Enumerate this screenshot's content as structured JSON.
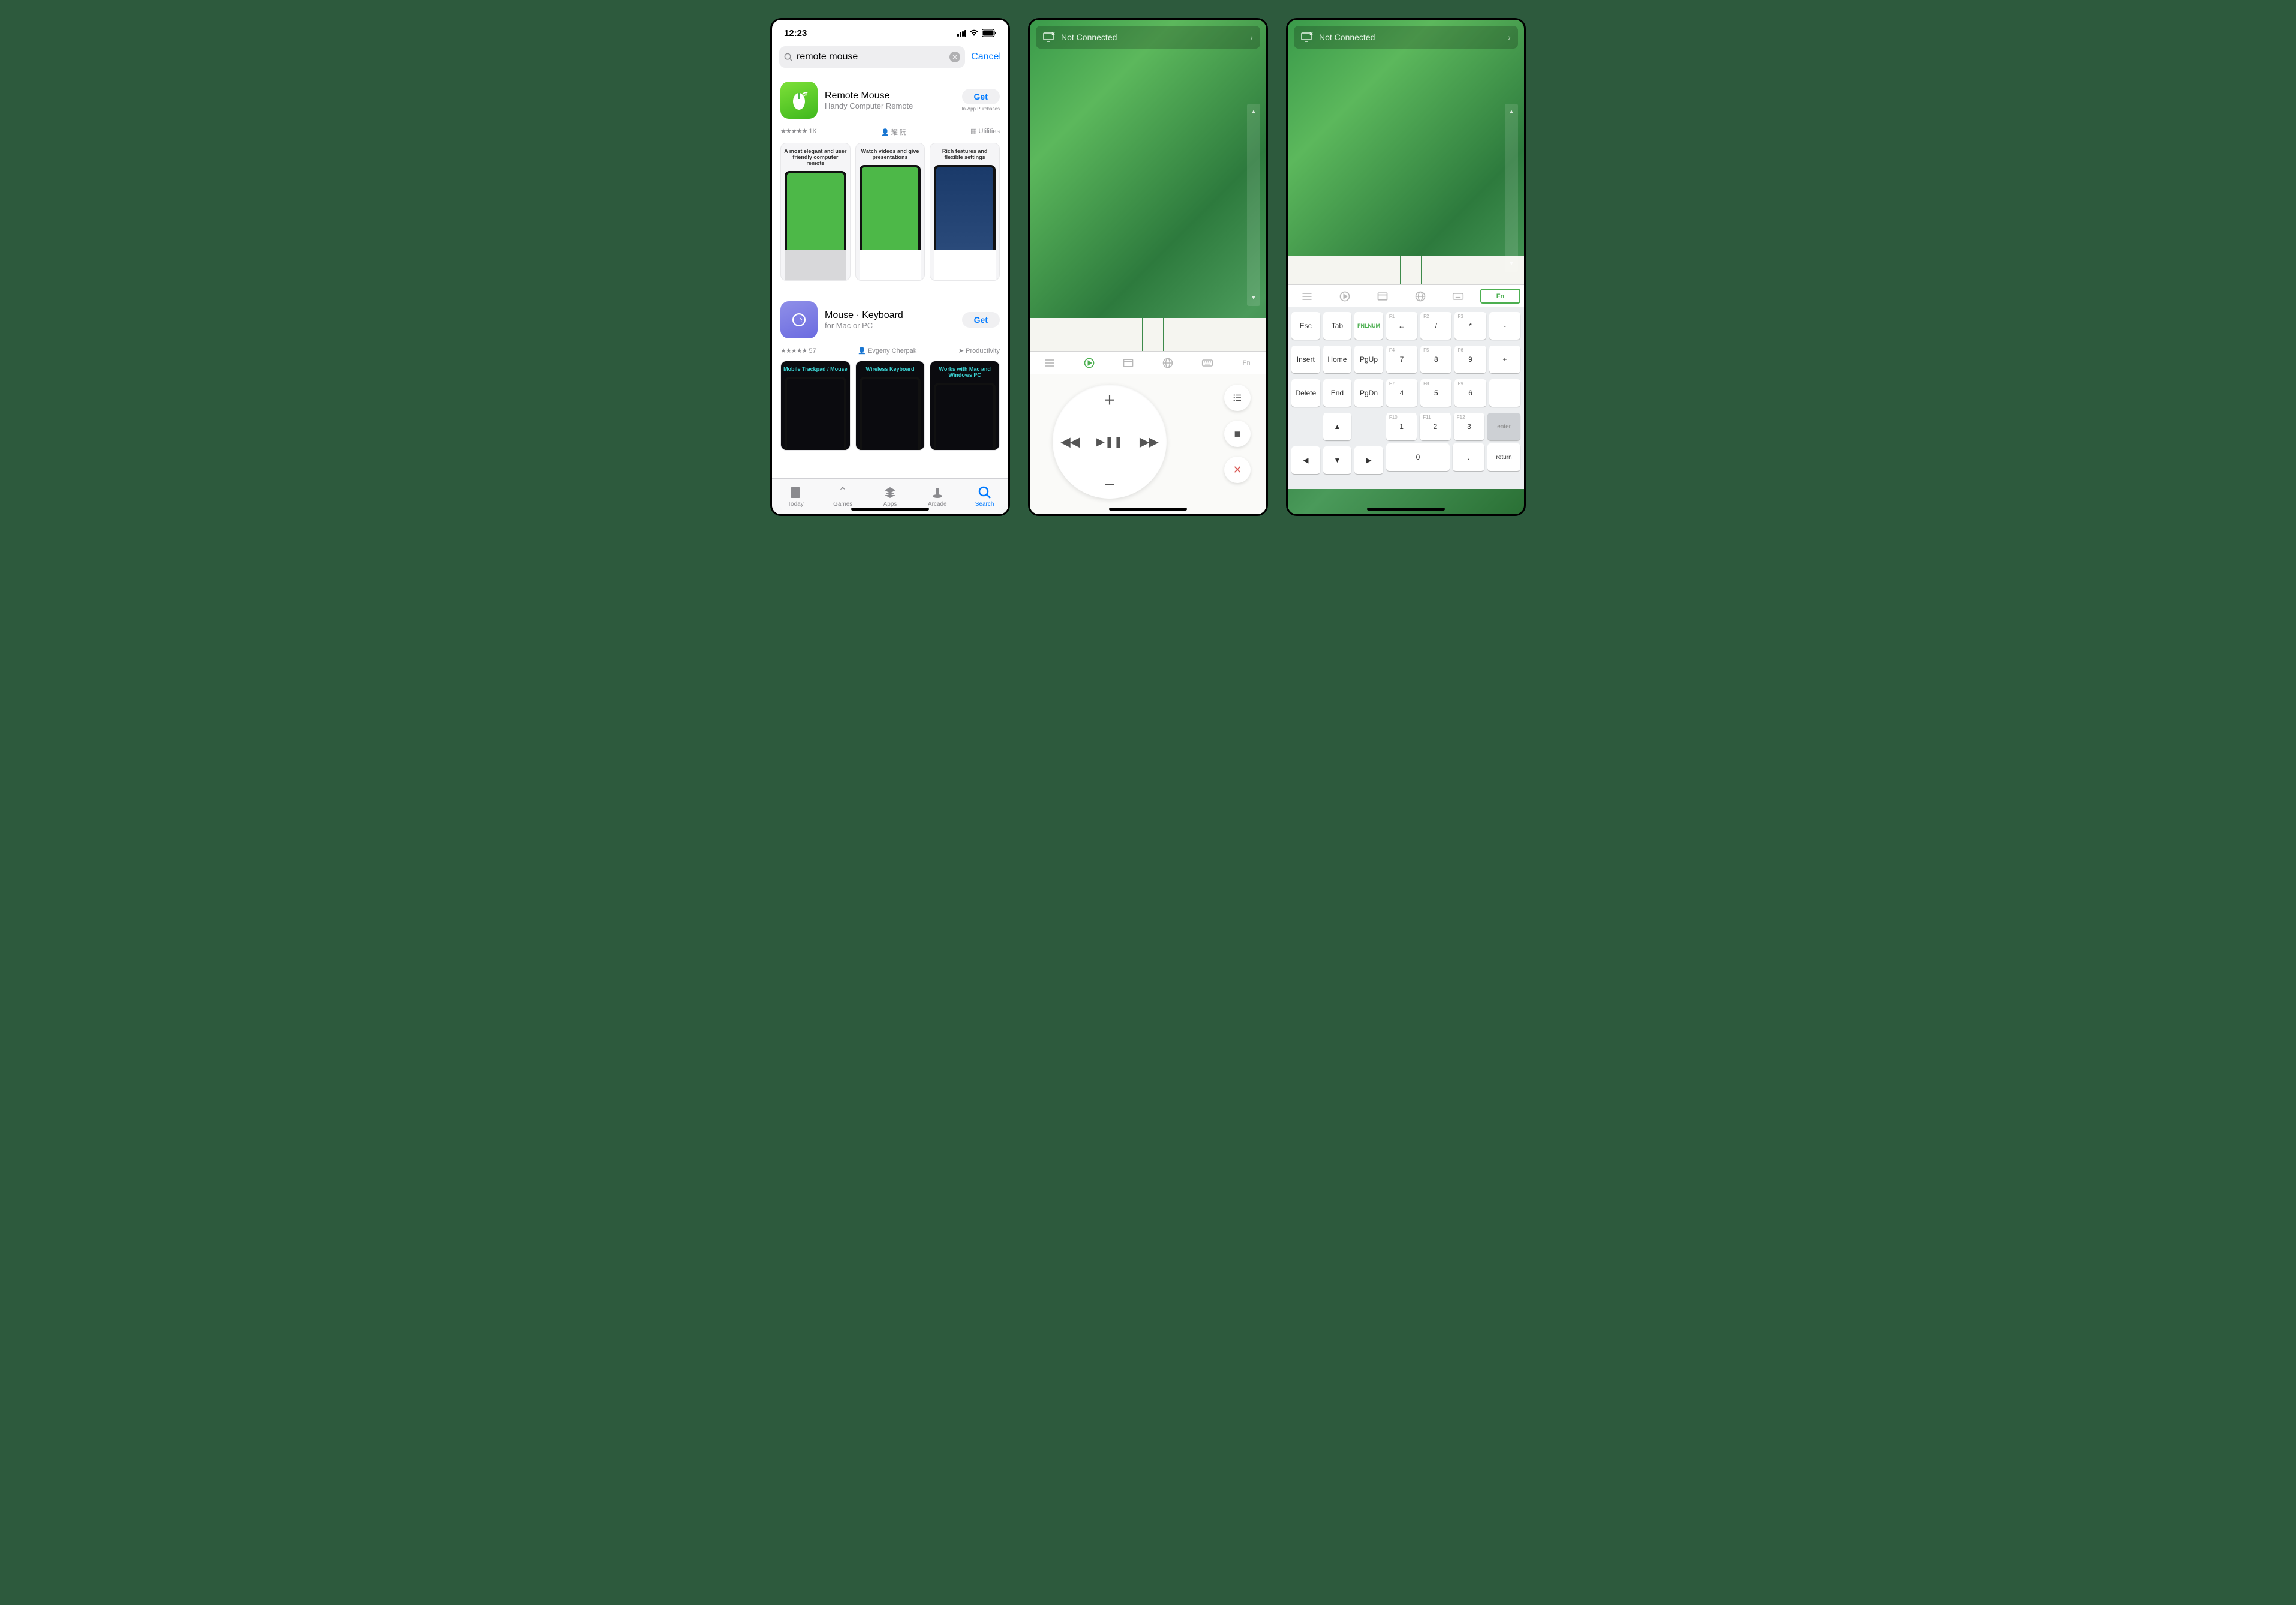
{
  "appstore": {
    "status": {
      "time": "12:23"
    },
    "search": {
      "value": "remote mouse",
      "cancel": "Cancel"
    },
    "apps": [
      {
        "title": "Remote Mouse",
        "subtitle": "Handy Computer Remote",
        "get": "Get",
        "iap": "In-App Purchases",
        "rating_stars": "★★★★★",
        "rating_count": "1K",
        "developer": "耀 阮",
        "category": "Utilities",
        "shots": [
          "A most elegant and user friendly computer remote",
          "Watch videos and give presentations",
          "Rich features and flexible settings"
        ]
      },
      {
        "title": "Mouse · Keyboard",
        "subtitle": "for Mac or PC",
        "get": "Get",
        "iap": "",
        "rating_stars": "★★★★★",
        "rating_count": "57",
        "developer": "Evgeny Cherpak",
        "category": "Productivity",
        "shots": [
          "Mobile Trackpad / Mouse",
          "Wireless Keyboard",
          "Works with Mac and Windows PC"
        ]
      }
    ],
    "tabs": {
      "today": "Today",
      "games": "Games",
      "apps": "Apps",
      "arcade": "Arcade",
      "search": "Search"
    }
  },
  "remote": {
    "banner": "Not Connected",
    "media": {
      "play_pause": "▶❚❚",
      "vol_up": "＋",
      "vol_down": "－",
      "rw": "◀◀",
      "ff": "▶▶",
      "list": "≡",
      "stop": "■",
      "close": "✕"
    },
    "modebar_fn": "Fn"
  },
  "fnkeys": {
    "r1": {
      "esc": "Esc",
      "tab": "Tab",
      "numlock_top": "FN",
      "numlock_bot": "LNUM",
      "f1": {
        "sup": "F1",
        "lbl": "←"
      },
      "f2": {
        "sup": "F2",
        "lbl": "/"
      },
      "f3": {
        "sup": "F3",
        "lbl": "*"
      },
      "minus": "-"
    },
    "r2": {
      "insert": "Insert",
      "home": "Home",
      "pgup": "PgUp",
      "f4": {
        "sup": "F4",
        "lbl": "7"
      },
      "f5": {
        "sup": "F5",
        "lbl": "8"
      },
      "f6": {
        "sup": "F6",
        "lbl": "9"
      },
      "plus": "+"
    },
    "r3": {
      "delete": "Delete",
      "end": "End",
      "pgdn": "PgDn",
      "f7": {
        "sup": "F7",
        "lbl": "4"
      },
      "f8": {
        "sup": "F8",
        "lbl": "5"
      },
      "f9": {
        "sup": "F9",
        "lbl": "6"
      },
      "eq": "="
    },
    "r4": {
      "up": "▲",
      "f10": {
        "sup": "F10",
        "lbl": "1"
      },
      "f11": {
        "sup": "F11",
        "lbl": "2"
      },
      "f12": {
        "sup": "F12",
        "lbl": "3"
      },
      "enter": "enter"
    },
    "r5": {
      "left": "◀",
      "down": "▼",
      "right": "▶",
      "zero": "0",
      "dot": ".",
      "return": "return"
    }
  }
}
